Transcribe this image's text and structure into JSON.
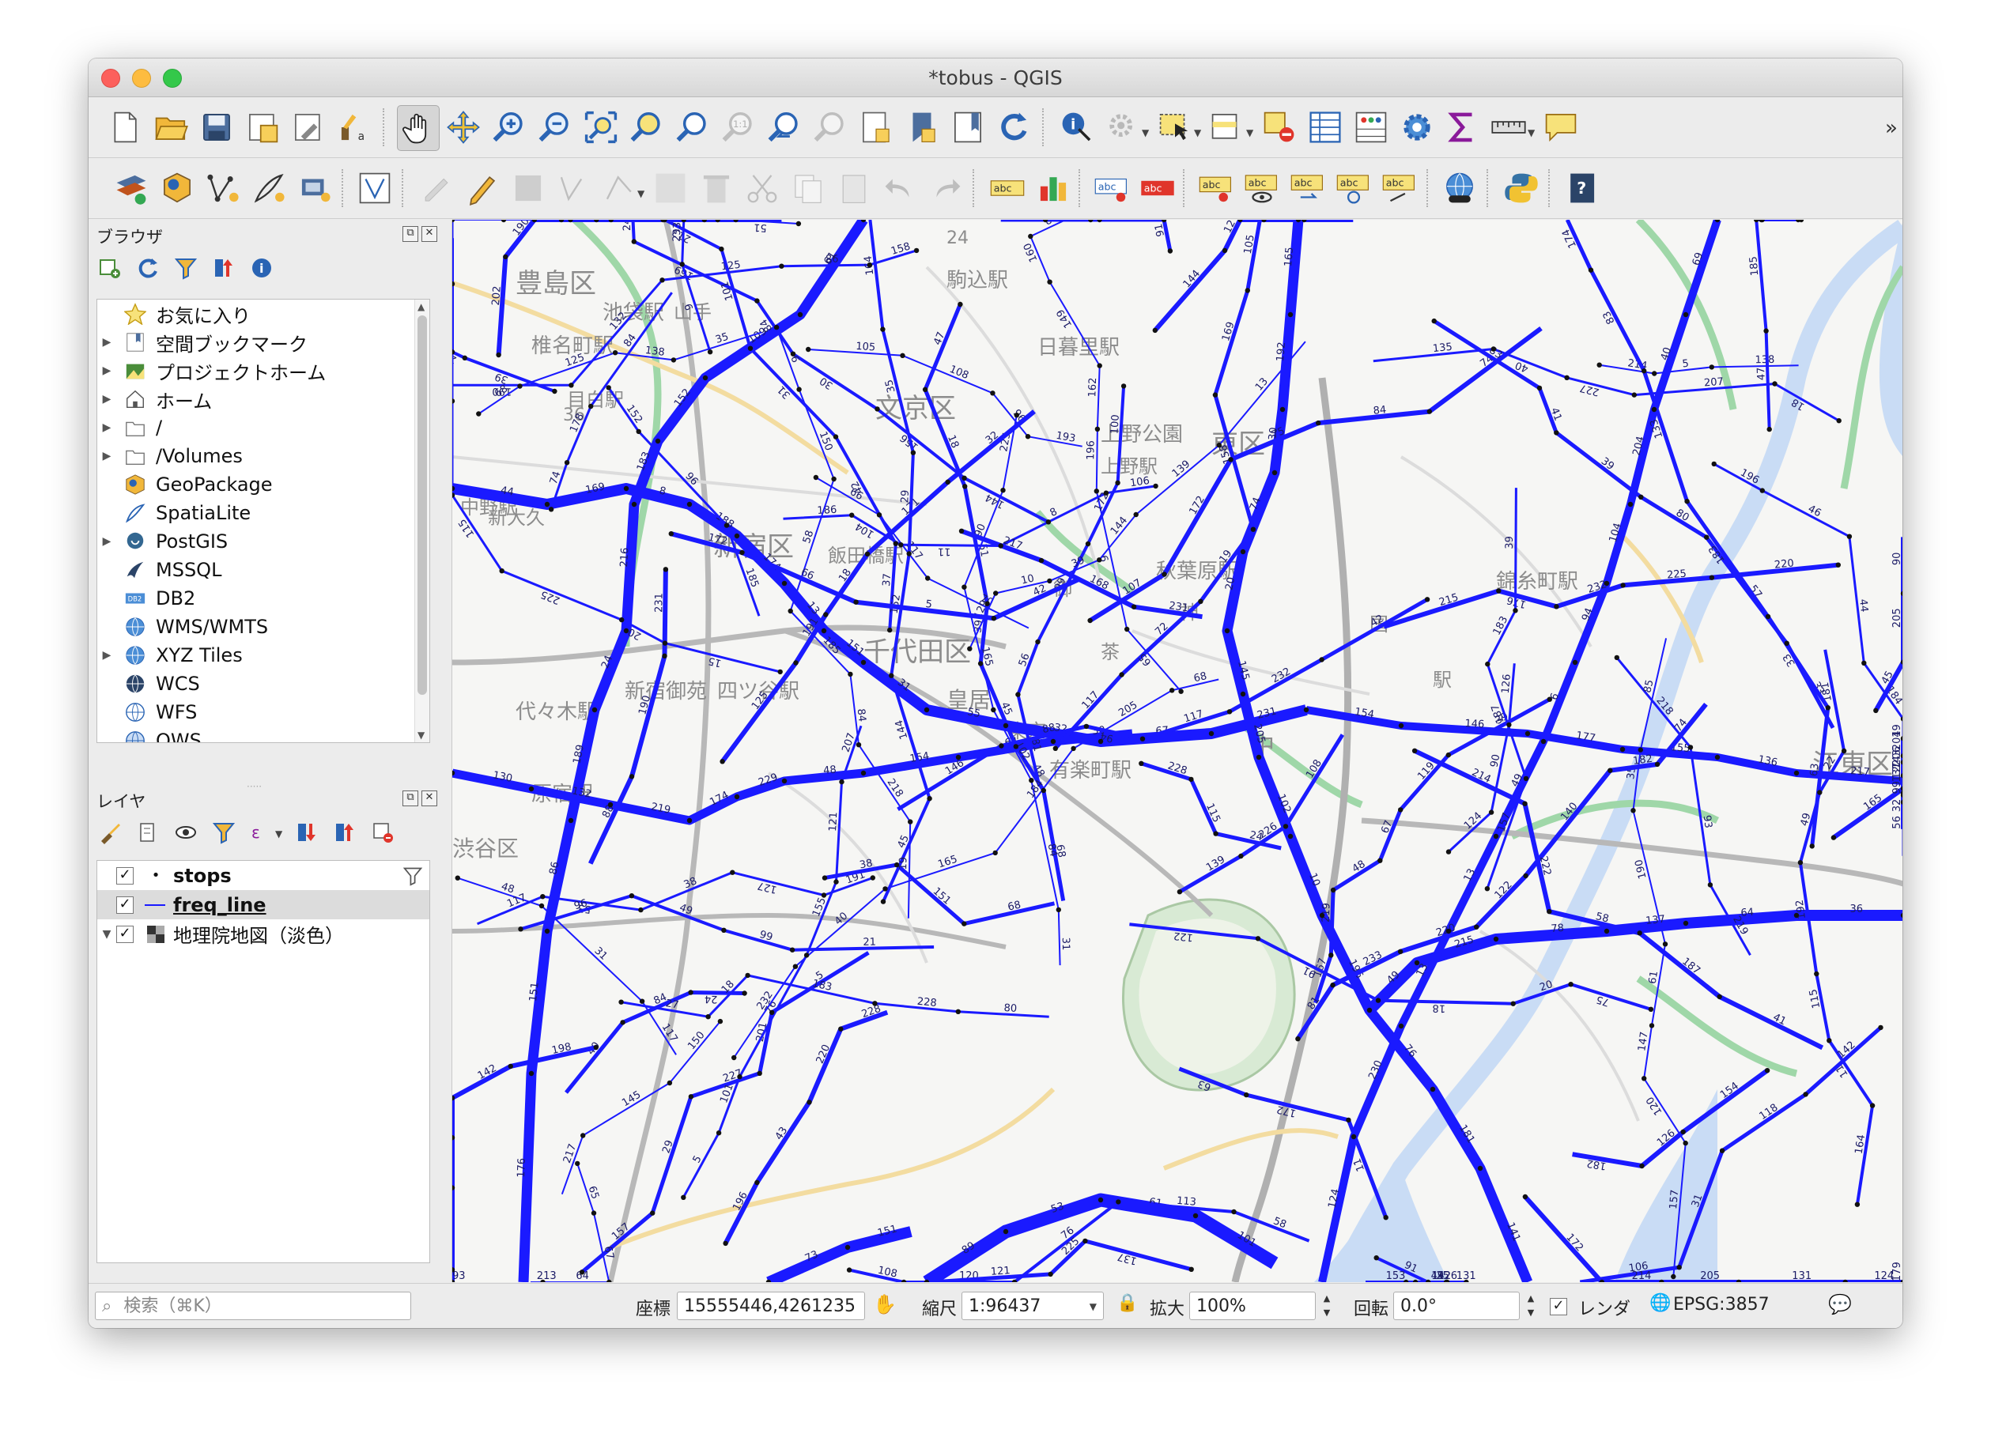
{
  "window": {
    "title": "*tobus - QGIS"
  },
  "toolbar1": {
    "icons": [
      "new-project-icon",
      "open-project-icon",
      "save-project-icon",
      "save-as-icon",
      "print-layout-icon",
      "style-manager-icon",
      "pan-hand-icon",
      "pan-to-selection-icon",
      "zoom-in-icon",
      "zoom-out-icon",
      "zoom-full-icon",
      "zoom-to-selection-icon",
      "zoom-to-layer-icon",
      "zoom-native-icon",
      "zoom-last-icon",
      "zoom-next-icon",
      "new-bookmark-icon",
      "show-bookmarks-icon",
      "map-tips-icon",
      "refresh-icon",
      "identify-icon",
      "actions-icon",
      "select-icon",
      "attribute-select-icon",
      "deselect-icon",
      "attribute-table-icon",
      "field-calculator-icon",
      "processing-toolbox-icon",
      "statistics-sum-icon",
      "measure-icon",
      "annotation-icon"
    ],
    "overflow_label": "»"
  },
  "toolbar2": {
    "icons": [
      "add-layer-icon",
      "add-geopackage-icon",
      "new-vector-icon",
      "digitize-icon",
      "new-temp-layer-icon",
      "vertex-tool-icon",
      "edit-layer-icon",
      "pencil-icon",
      "save-edits-icon",
      "add-feature-icon",
      "delete-icon",
      "cut-icon",
      "copy-icon",
      "paste-icon",
      "undo-icon",
      "redo-icon",
      "label-icon",
      "diagram-icon",
      "pin-label-icon",
      "highlight-label-icon",
      "move-label-icon",
      "show-label-icon",
      "rotate-label-icon",
      "change-label-icon",
      "plugins-icon",
      "python-icon",
      "help-icon"
    ],
    "label_text": "abc"
  },
  "browser_panel": {
    "title": "ブラウザ",
    "items": [
      {
        "label": "お気に入り",
        "icon": "star-icon",
        "expandable": false
      },
      {
        "label": "空間ブックマーク",
        "icon": "bookmark-icon",
        "expandable": true
      },
      {
        "label": "プロジェクトホーム",
        "icon": "project-home-icon",
        "expandable": true
      },
      {
        "label": "ホーム",
        "icon": "home-icon",
        "expandable": true
      },
      {
        "label": "/",
        "icon": "folder-icon",
        "expandable": true
      },
      {
        "label": "/Volumes",
        "icon": "folder-icon",
        "expandable": true
      },
      {
        "label": "GeoPackage",
        "icon": "geopackage-icon",
        "expandable": false
      },
      {
        "label": "SpatiaLite",
        "icon": "spatialite-icon",
        "expandable": false
      },
      {
        "label": "PostGIS",
        "icon": "postgis-icon",
        "expandable": true
      },
      {
        "label": "MSSQL",
        "icon": "mssql-icon",
        "expandable": false
      },
      {
        "label": "DB2",
        "icon": "db2-icon",
        "expandable": false
      },
      {
        "label": "WMS/WMTS",
        "icon": "wms-icon",
        "expandable": false
      },
      {
        "label": "XYZ Tiles",
        "icon": "xyz-icon",
        "expandable": true
      },
      {
        "label": "WCS",
        "icon": "wcs-icon",
        "expandable": false
      },
      {
        "label": "WFS",
        "icon": "wfs-icon",
        "expandable": false
      },
      {
        "label": "OWS",
        "icon": "ows-icon",
        "expandable": false
      }
    ]
  },
  "layers_panel": {
    "title": "レイヤ",
    "layers": [
      {
        "label": "stops",
        "checked": true,
        "symbol": "point",
        "bold": true
      },
      {
        "label": "freq_line",
        "checked": true,
        "symbol": "line",
        "bold": true,
        "selected": true
      },
      {
        "label": "地理院地図（淡色）",
        "checked": true,
        "symbol": "raster",
        "bold": false
      }
    ]
  },
  "map": {
    "place_labels": [
      "豊島区",
      "池袋駅",
      "椎名町駅",
      "目白駅",
      "文京区",
      "駒込駅",
      "日暮里駅",
      "上野公園",
      "上野駅",
      "東区",
      "秋葉原駅",
      "錦糸町駅",
      "新宿区",
      "飯田橋駅",
      "千代田区",
      "皇居",
      "東京",
      "有楽町駅",
      "新宿御苑",
      "四ツ谷駅",
      "代々木駅",
      "原宿駅",
      "渋谷区",
      "新大久",
      "中野駅",
      "江東区",
      "中",
      "茶",
      "御",
      "神",
      "国",
      "駅",
      "山手",
      "36",
      "24",
      "1:1"
    ],
    "route_color": "#1a1aff",
    "basemap_color": "#f6f6f4"
  },
  "statusbar": {
    "search_placeholder": "検索（⌘K）",
    "coord_label": "座標",
    "coord_value": "15555446,4261235",
    "scale_label": "縮尺",
    "scale_value": "1:96437",
    "magnify_label": "拡大",
    "magnify_value": "100%",
    "rotation_label": "回転",
    "rotation_value": "0.0°",
    "render_label": "レンダ",
    "render_checked": true,
    "crs_label": "EPSG:3857"
  }
}
